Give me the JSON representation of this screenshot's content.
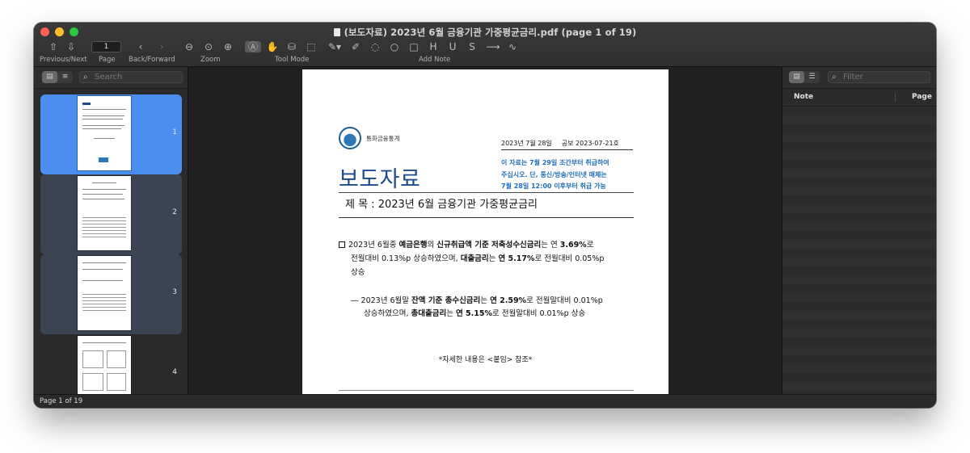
{
  "window": {
    "title": "(보도자료) 2023년 6월 금융기관 가중평균금리.pdf (page 1 of 19)"
  },
  "toolbar": {
    "prev_next_label": "Previous/Next",
    "page_label": "Page",
    "page_value": "1",
    "back_forward_label": "Back/Forward",
    "zoom_label": "Zoom",
    "tool_mode_label": "Tool Mode",
    "add_note_label": "Add Note"
  },
  "left_sidebar": {
    "search_placeholder": "Search",
    "thumbnails": [
      {
        "page": "1",
        "selected": true
      },
      {
        "page": "2",
        "selected": false
      },
      {
        "page": "3",
        "selected": false
      },
      {
        "page": "4",
        "selected": false
      }
    ]
  },
  "right_sidebar": {
    "filter_placeholder": "Filter",
    "col_note": "Note",
    "col_page": "Page"
  },
  "document": {
    "org_name": "통화금융통계",
    "date": "2023년  7월  28일",
    "bulletin": "공보 2023-07-21호",
    "heading": "보도자료",
    "embargo": [
      "이 자료는 7월 29일 조간부터 취급하여",
      "주십시오. 단, 통신/방송/인터넷 매체는",
      "7월 28일 12:00 이후부터 취급 가능"
    ],
    "subject": "제  목 : 2023년 6월 금융기관 가중평균금리",
    "p1_line1_a": "2023년 6월중 ",
    "p1_line1_b": "예금은행",
    "p1_line1_c": "의 ",
    "p1_line1_d": "신규취급액 기준 저축성수신금리",
    "p1_line1_e": "는 연 ",
    "p1_line1_f": "3.69%",
    "p1_line1_g": "로",
    "p1_line2_a": "전월대비 0.13%p 상승하였으며, ",
    "p1_line2_b": "대출금리",
    "p1_line2_c": "는 ",
    "p1_line2_d": "연 5.17%",
    "p1_line2_e": "로 전월대비 0.05%p",
    "p1_line3": "상승",
    "p2_line1_a": "― 2023년 6월말 ",
    "p2_line1_b": "잔액 기준 총수신금리",
    "p2_line1_c": "는 ",
    "p2_line1_d": "연 2.59%",
    "p2_line1_e": "로 전월말대비 0.01%p",
    "p2_line2_a": "상승하였으며, ",
    "p2_line2_b": "총대출금리",
    "p2_line2_c": "는 ",
    "p2_line2_d": "연 5.15%",
    "p2_line2_e": "로 전월말대비 0.01%p 상승",
    "reference": "*자세한 내용은 <붙임> 참조*"
  },
  "status": {
    "page_info": "Page 1 of 19"
  },
  "colors": {
    "selection": "#4a8ef0",
    "heading_blue": "#1b4b8c",
    "embargo_blue": "#1e6fb8"
  }
}
